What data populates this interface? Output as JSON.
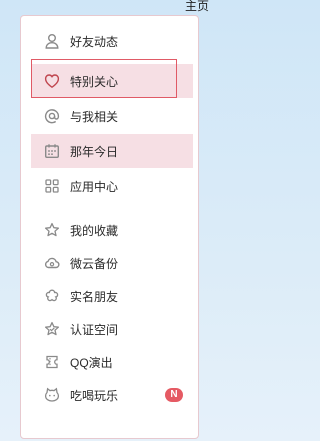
{
  "topbar": {
    "link_label": "主页"
  },
  "menu": {
    "items": [
      {
        "label": "好友动态",
        "icon": "person-icon",
        "highlighted": false
      },
      {
        "label": "特别关心",
        "icon": "heart-icon",
        "highlighted": true
      },
      {
        "label": "与我相关",
        "icon": "at-icon",
        "highlighted": false
      },
      {
        "label": "那年今日",
        "icon": "calendar-icon",
        "highlighted": true
      },
      {
        "label": "应用中心",
        "icon": "grid-icon",
        "highlighted": false
      },
      {
        "label": "我的收藏",
        "icon": "star-icon",
        "highlighted": false
      },
      {
        "label": "微云备份",
        "icon": "cloud-icon",
        "highlighted": false
      },
      {
        "label": "实名朋友",
        "icon": "flower-icon",
        "highlighted": false
      },
      {
        "label": "认证空间",
        "icon": "badge-star-icon",
        "highlighted": false
      },
      {
        "label": "QQ演出",
        "icon": "ticket-icon",
        "highlighted": false
      },
      {
        "label": "吃喝玩乐",
        "icon": "cat-icon",
        "highlighted": false,
        "badge": "N"
      }
    ]
  },
  "colors": {
    "accent": "#e05a66",
    "highlight_bg": "#f6dfe4",
    "icon": "#8a8a8a",
    "heart": "#c0464f"
  }
}
